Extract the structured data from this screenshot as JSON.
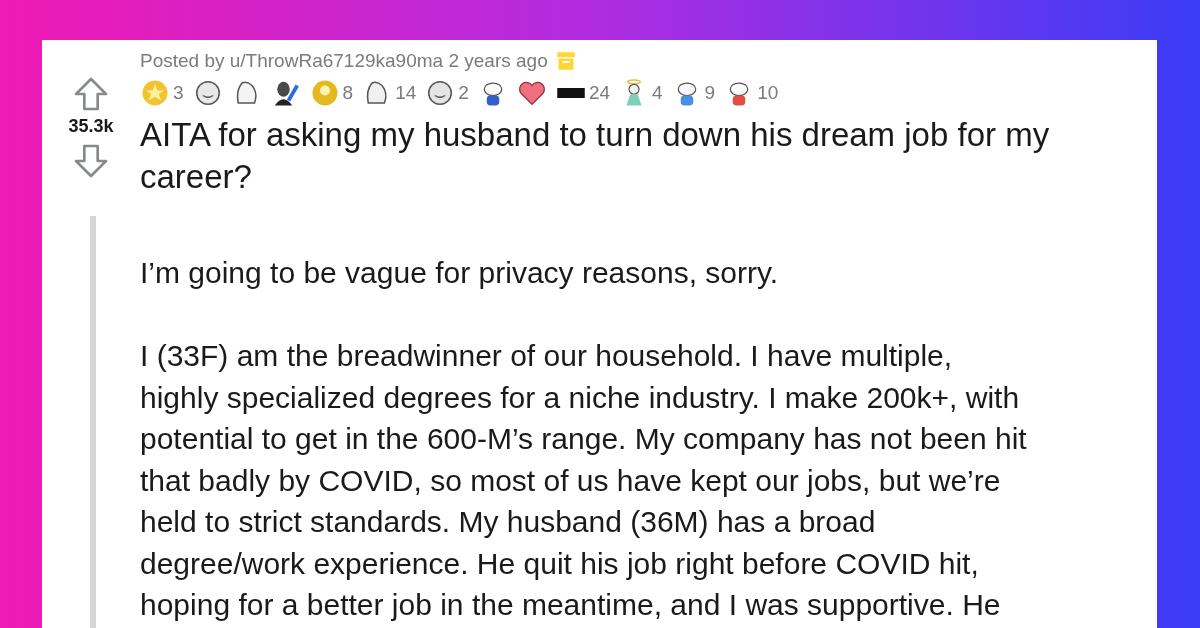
{
  "post": {
    "score": "35.3k",
    "posted_by": "Posted by u/ThrowRa67129ka90ma 2 years ago",
    "archived": true,
    "awards": [
      {
        "kind": "star",
        "color": "#f2c230",
        "count": "3"
      },
      {
        "kind": "face",
        "color": "#e8e8e8"
      },
      {
        "kind": "hand",
        "color": "#f4f4f4"
      },
      {
        "kind": "bust",
        "color": "#4a4a4a"
      },
      {
        "kind": "gold",
        "color": "#e6b820",
        "count": "8"
      },
      {
        "kind": "hands",
        "color": "#f0f0f0",
        "count": "14"
      },
      {
        "kind": "face",
        "color": "#e4e4e4",
        "count": "2"
      },
      {
        "kind": "snoo",
        "color": "#3060c8"
      },
      {
        "kind": "heart",
        "color": "#f07080"
      },
      {
        "kind": "bar",
        "color": "#111111",
        "count": "24"
      },
      {
        "kind": "angel",
        "color": "#7cd0b8",
        "count": "4"
      },
      {
        "kind": "snoo",
        "color": "#4a90e0",
        "count": "9"
      },
      {
        "kind": "snoo",
        "color": "#e05040",
        "count": "10"
      }
    ],
    "title": "AITA for asking my husband to turn down his dream job for my career?",
    "paragraphs": [
      [
        "I’m going to be vague for privacy reasons, sorry."
      ],
      [
        "I (33F) am the breadwinner of our household. I have multiple,",
        "highly specialized degrees for a niche industry. I make 200k+, with",
        "potential to get in the 600-M’s range. My company has not been hit",
        "that badly by COVID, so most of us have kept our jobs, but we’re",
        "held to strict standards. My husband (36M) has a broad",
        "degree/work experience. He quit his job right before COVID hit,",
        "hoping for a better job in the meantime, and I was supportive. He"
      ]
    ]
  }
}
